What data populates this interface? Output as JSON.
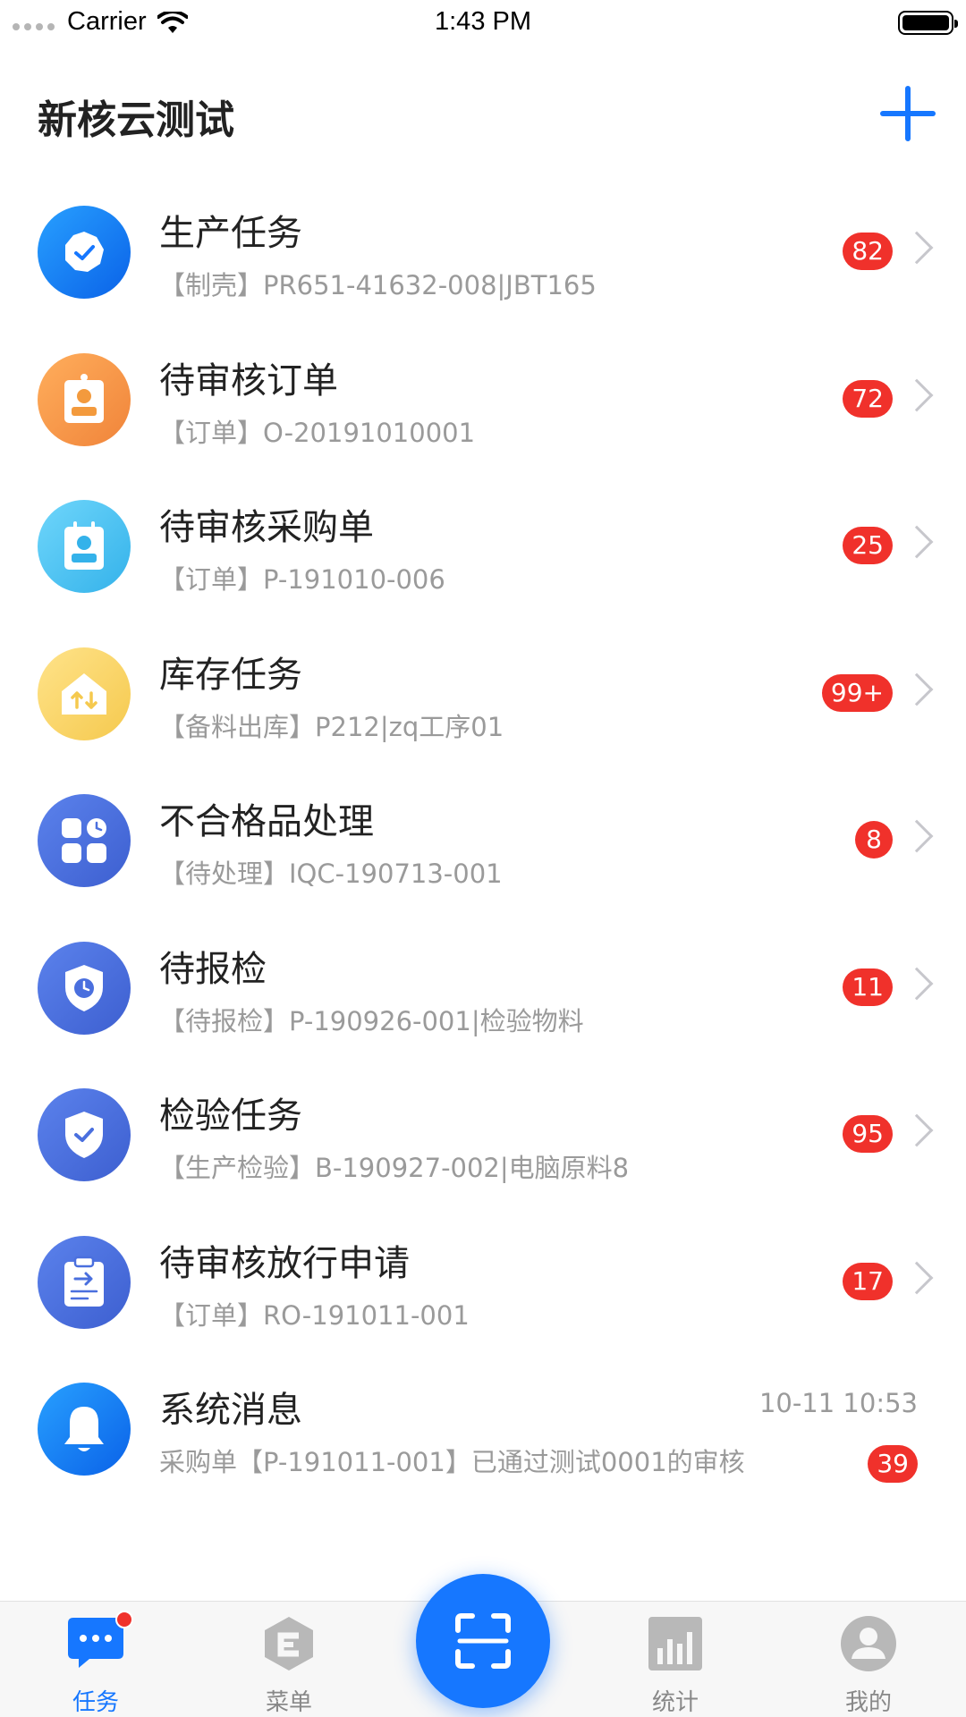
{
  "status_bar": {
    "carrier": "Carrier",
    "time": "1:43 PM"
  },
  "header": {
    "title": "新核云测试",
    "add_icon": "plus-icon",
    "accent": "#1677ff"
  },
  "tasks": [
    {
      "title": "生产任务",
      "subtitle": "【制壳】PR651-41632-008|JBT165",
      "badge": "82",
      "icon": "check-badge-icon",
      "color": "#1677ff"
    },
    {
      "title": "待审核订单",
      "subtitle": "【订单】O-20191010001",
      "badge": "72",
      "icon": "id-card-icon",
      "color": "#f39a3d"
    },
    {
      "title": "待审核采购单",
      "subtitle": "【订单】P-191010-006",
      "badge": "25",
      "icon": "contact-card-icon",
      "color": "#4cc3f0"
    },
    {
      "title": "库存任务",
      "subtitle": "【备料出库】P212|zq工序01",
      "badge": "99+",
      "icon": "warehouse-icon",
      "color": "#f8d66a"
    },
    {
      "title": "不合格品处理",
      "subtitle": "【待处理】IQC-190713-001",
      "badge": "8",
      "icon": "grid-clock-icon",
      "color": "#4a6fde"
    },
    {
      "title": "待报检",
      "subtitle": "【待报检】P-190926-001|检验物料",
      "badge": "11",
      "icon": "shield-clock-icon",
      "color": "#4a6fde"
    },
    {
      "title": "检验任务",
      "subtitle": "【生产检验】B-190927-002|电脑原料8",
      "badge": "95",
      "icon": "shield-check-icon",
      "color": "#4a6fde"
    },
    {
      "title": "待审核放行申请",
      "subtitle": "【订单】RO-191011-001",
      "badge": "17",
      "icon": "clipboard-icon",
      "color": "#4a6fde"
    }
  ],
  "message": {
    "title": "系统消息",
    "subtitle": "采购单【P-191011-001】已通过测试0001的审核",
    "time": "10-11 10:53",
    "badge": "39",
    "icon": "bell-icon",
    "color": "#1677ff"
  },
  "tabs": [
    {
      "label": "任务",
      "icon": "chat-icon",
      "active": true
    },
    {
      "label": "菜单",
      "icon": "menu-cube-icon",
      "active": false
    },
    {
      "label": "统计",
      "icon": "bar-chart-icon",
      "active": false
    },
    {
      "label": "我的",
      "icon": "user-icon",
      "active": false
    }
  ],
  "scan": {
    "icon": "scan-icon"
  }
}
